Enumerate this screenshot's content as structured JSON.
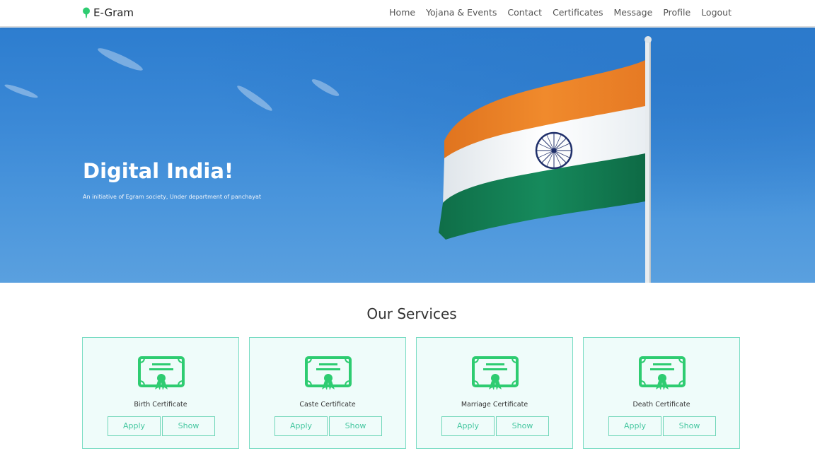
{
  "navbar": {
    "brand": "E-Gram",
    "links": [
      "Home",
      "Yojana & Events",
      "Contact",
      "Certificates",
      "Message",
      "Profile",
      "Logout"
    ]
  },
  "hero": {
    "title": "Digital India!",
    "subtitle": "An initiative of Egram society, Under department of panchayat"
  },
  "services": {
    "title": "Our Services",
    "cards": [
      {
        "title": "Birth Certificate",
        "apply": "Apply",
        "show": "Show"
      },
      {
        "title": "Caste Certificate",
        "apply": "Apply",
        "show": "Show"
      },
      {
        "title": "Marriage Certificate",
        "apply": "Apply",
        "show": "Show"
      },
      {
        "title": "Death Certificate",
        "apply": "Apply",
        "show": "Show"
      }
    ]
  },
  "colors": {
    "accent": "#2ecc71",
    "button_text": "#45c7a0",
    "card_bg": "#effcfa",
    "hero_sky": "#3a88d6"
  },
  "icons": [
    "map-pin-icon",
    "certificate-icon"
  ]
}
